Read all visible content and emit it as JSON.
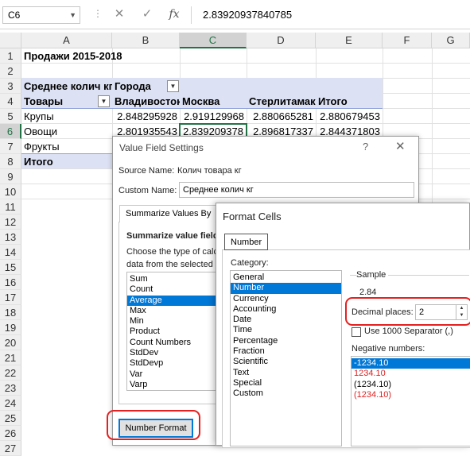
{
  "formula_bar": {
    "name_box": "C6",
    "cancel_icon": "✕",
    "enter_icon": "✓",
    "fx_icon": "fx",
    "formula": "2.83920937840785"
  },
  "columns": [
    "A",
    "B",
    "C",
    "D",
    "E",
    "F",
    "G"
  ],
  "rows": [
    "1",
    "2",
    "3",
    "4",
    "5",
    "6",
    "7",
    "8",
    "9",
    "10",
    "11",
    "12",
    "13",
    "14",
    "15",
    "16",
    "17",
    "18",
    "19",
    "20",
    "21",
    "22",
    "23",
    "24",
    "25",
    "26",
    "27"
  ],
  "sheet": {
    "a1": "Продажи 2015-2018",
    "a3": "Среднее колич кг",
    "b3": "Города",
    "a4": "Товары",
    "b4": "Владивосток",
    "c4": "Москва",
    "d4": "Стерлитамак",
    "e4": "Итого",
    "r5": [
      "Крупы",
      "2.848295928",
      "2.919129968",
      "2.880665281",
      "2.880679453"
    ],
    "r6": [
      "Овощи",
      "2.801935543",
      "2.839209378",
      "2.896817337",
      "2.844371803"
    ],
    "a7": "Фрукты",
    "a8": "Итого"
  },
  "value_field_settings": {
    "title": "Value Field Settings",
    "help": "?",
    "close": "✕",
    "source_name_label": "Source Name:",
    "source_name_value": "Колич товара кг",
    "custom_name_label": "Custom Name:",
    "custom_name_value": "Среднее колич кг",
    "tab_summarize": "Summarize Values By",
    "section_heading": "Summarize value field b",
    "desc_line1": "Choose the type of calcu",
    "desc_line2": "data from the selected fi",
    "functions": [
      "Sum",
      "Count",
      "Average",
      "Max",
      "Min",
      "Product",
      "Count Numbers",
      "StdDev",
      "StdDevp",
      "Var",
      "Varp"
    ],
    "selected_function": "Average",
    "number_format_button": "Number Format"
  },
  "format_cells": {
    "title": "Format Cells",
    "tab_number": "Number",
    "category_label": "Category:",
    "categories": [
      "General",
      "Number",
      "Currency",
      "Accounting",
      "Date",
      "Time",
      "Percentage",
      "Fraction",
      "Scientific",
      "Text",
      "Special",
      "Custom"
    ],
    "selected_category": "Number",
    "sample_label": "Sample",
    "sample_value": "2.84",
    "decimal_places_label": "Decimal places:",
    "decimal_places_value": "2",
    "separator_label": "Use 1000 Separator (,)",
    "negative_numbers_label": "Negative numbers:",
    "negative_options": [
      "-1234.10",
      "1234.10",
      "(1234.10)",
      "(1234.10)"
    ]
  },
  "colors": {
    "excel_green": "#217346",
    "selection_blue": "#0078d7",
    "pivot_band": "#dce1f3",
    "annotation_red": "#e52020",
    "negative_red": "#e02020"
  }
}
